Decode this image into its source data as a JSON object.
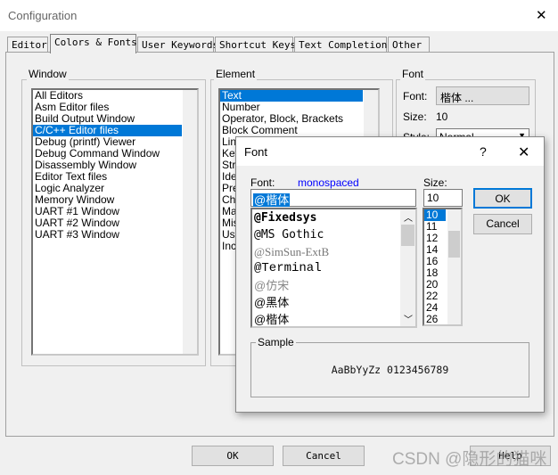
{
  "window": {
    "title": "Configuration",
    "close": "✕"
  },
  "tabs": [
    {
      "label": "Editor"
    },
    {
      "label": "Colors & Fonts"
    },
    {
      "label": "User Keywords"
    },
    {
      "label": "Shortcut Keys"
    },
    {
      "label": "Text Completion"
    },
    {
      "label": "Other"
    }
  ],
  "window_group": {
    "label": "Window",
    "items": [
      "All Editors",
      "Asm Editor files",
      "Build Output Window",
      "C/C++ Editor files",
      "Debug (printf) Viewer",
      "Debug Command Window",
      "Disassembly Window",
      "Editor Text files",
      "Logic Analyzer",
      "Memory Window",
      "UART #1 Window",
      "UART #2 Window",
      "UART #3 Window"
    ],
    "selected": 3
  },
  "element_group": {
    "label": "Element",
    "items": [
      "Text",
      "Number",
      "Operator, Block, Brackets",
      "Block Comment",
      "Lin",
      "Key",
      "Stri",
      "Ide",
      "Pre",
      "Cha",
      "Mat",
      "Mis",
      "Use",
      "Inc"
    ],
    "selected": 0
  },
  "font_group": {
    "label": "Font",
    "font_label": "Font:",
    "font_value": "楷体 ...",
    "size_label": "Size:",
    "size_value": "10",
    "style_label": "Style:",
    "style_value": "Normal"
  },
  "buttons": {
    "ok": "OK",
    "cancel": "Cancel",
    "help": "Help"
  },
  "font_dialog": {
    "title": "Font",
    "help": "?",
    "close": "✕",
    "font_label": "Font:",
    "font_hint": "monospaced",
    "font_input": "@楷体",
    "fonts": [
      "@Fixedsys",
      "@MS Gothic",
      "@SimSun-ExtB",
      "@Terminal",
      "@仿宋",
      "@黑体",
      "@楷体"
    ],
    "selected_font": 6,
    "size_label": "Size:",
    "size_input": "10",
    "sizes": [
      "10",
      "11",
      "12",
      "14",
      "16",
      "18",
      "20",
      "22",
      "24",
      "26"
    ],
    "selected_size": 0,
    "ok": "OK",
    "cancel": "Cancel",
    "sample_label": "Sample",
    "sample_text": "AaBbYyZz 0123456789",
    "hint_color": "#0000ff"
  },
  "watermark": "CSDN @隐形的猫咪"
}
